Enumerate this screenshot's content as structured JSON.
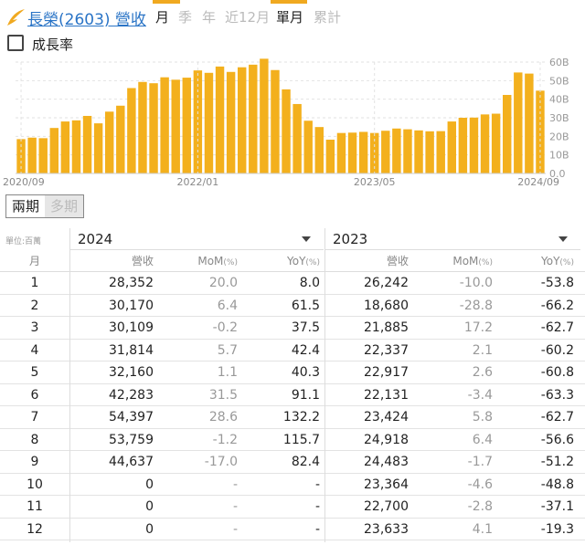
{
  "header": {
    "title": "長榮(2603) 營收",
    "tabs": [
      {
        "label": "月",
        "active": true
      },
      {
        "label": "季",
        "active": false
      },
      {
        "label": "年",
        "active": false
      },
      {
        "label": "近12月",
        "active": false
      },
      {
        "label": "單月",
        "active": true
      },
      {
        "label": "累計",
        "active": false
      }
    ]
  },
  "growth": {
    "label": "成長率",
    "checked": false
  },
  "chart_data": {
    "type": "bar",
    "bar_color": "#f3b01d",
    "x_tick_labels": [
      "2020/09",
      "2022/01",
      "2023/05",
      "2024/09"
    ],
    "y_tick_labels": [
      "0.0",
      "10B",
      "20B",
      "30B",
      "40B",
      "50B",
      "60B"
    ],
    "ylim": [
      0,
      60
    ],
    "values": [
      18.5,
      19.3,
      19.0,
      24.5,
      28.0,
      28.6,
      31.0,
      27.0,
      33.3,
      36.5,
      46.0,
      49.3,
      48.6,
      51.8,
      50.5,
      51.6,
      55.5,
      54.2,
      57.6,
      54.7,
      57.2,
      58.6,
      61.8,
      55.7,
      45.3,
      37.4,
      28.4,
      25.0,
      18.2,
      21.8,
      22.0,
      22.4,
      21.8,
      23.0,
      24.2,
      23.8,
      23.2,
      22.7,
      22.8,
      28.0,
      30.0,
      30.1,
      31.8,
      32.2,
      42.3,
      54.4,
      53.8,
      44.6
    ]
  },
  "toggle": {
    "options": [
      "兩期",
      "多期"
    ],
    "active": 0
  },
  "table": {
    "unit_label": "單位:百萬",
    "year1": "2024",
    "year2": "2023",
    "headers": {
      "month": "月",
      "revenue": "營收",
      "mom": "MoM",
      "yoy": "YoY",
      "pct": "(%)"
    },
    "rows": [
      {
        "m": "1",
        "r1": "28,352",
        "mom1": "20.0",
        "yoy1": "8.0",
        "r2": "26,242",
        "mom2": "-10.0",
        "yoy2": "-53.8"
      },
      {
        "m": "2",
        "r1": "30,170",
        "mom1": "6.4",
        "yoy1": "61.5",
        "r2": "18,680",
        "mom2": "-28.8",
        "yoy2": "-66.2"
      },
      {
        "m": "3",
        "r1": "30,109",
        "mom1": "-0.2",
        "yoy1": "37.5",
        "r2": "21,885",
        "mom2": "17.2",
        "yoy2": "-62.7"
      },
      {
        "m": "4",
        "r1": "31,814",
        "mom1": "5.7",
        "yoy1": "42.4",
        "r2": "22,337",
        "mom2": "2.1",
        "yoy2": "-60.2"
      },
      {
        "m": "5",
        "r1": "32,160",
        "mom1": "1.1",
        "yoy1": "40.3",
        "r2": "22,917",
        "mom2": "2.6",
        "yoy2": "-60.8"
      },
      {
        "m": "6",
        "r1": "42,283",
        "mom1": "31.5",
        "yoy1": "91.1",
        "r2": "22,131",
        "mom2": "-3.4",
        "yoy2": "-63.3"
      },
      {
        "m": "7",
        "r1": "54,397",
        "mom1": "28.6",
        "yoy1": "132.2",
        "r2": "23,424",
        "mom2": "5.8",
        "yoy2": "-62.7"
      },
      {
        "m": "8",
        "r1": "53,759",
        "mom1": "-1.2",
        "yoy1": "115.7",
        "r2": "24,918",
        "mom2": "6.4",
        "yoy2": "-56.6"
      },
      {
        "m": "9",
        "r1": "44,637",
        "mom1": "-17.0",
        "yoy1": "82.4",
        "r2": "24,483",
        "mom2": "-1.7",
        "yoy2": "-51.2"
      },
      {
        "m": "10",
        "r1": "0",
        "mom1": "-",
        "yoy1": "-",
        "r2": "23,364",
        "mom2": "-4.6",
        "yoy2": "-48.8"
      },
      {
        "m": "11",
        "r1": "0",
        "mom1": "-",
        "yoy1": "-",
        "r2": "22,700",
        "mom2": "-2.8",
        "yoy2": "-37.1"
      },
      {
        "m": "12",
        "r1": "0",
        "mom1": "-",
        "yoy1": "-",
        "r2": "23,633",
        "mom2": "4.1",
        "yoy2": "-19.3"
      }
    ]
  }
}
